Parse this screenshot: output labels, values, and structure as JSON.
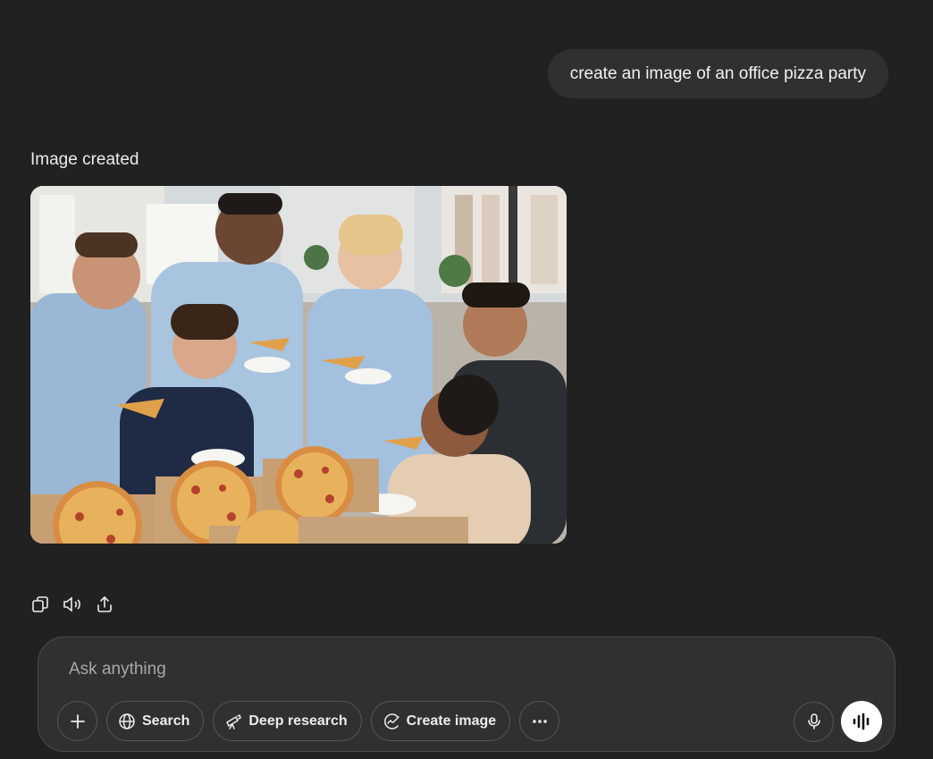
{
  "conversation": {
    "user_message": "create an image of an office pizza party",
    "assistant_label": "Image created"
  },
  "message_actions": [
    {
      "name": "copy-icon"
    },
    {
      "name": "read-aloud-icon"
    },
    {
      "name": "share-icon"
    }
  ],
  "composer": {
    "placeholder": "Ask anything",
    "tools": {
      "add_icon": "plus-icon",
      "search_label": "Search",
      "deep_research_label": "Deep research",
      "create_image_label": "Create image",
      "more_icon": "more-icon"
    },
    "mic_icon": "microphone-icon",
    "voice_icon": "voice-mode-icon"
  },
  "colors": {
    "background": "#212121",
    "bubble": "#303030",
    "composer": "#303030",
    "text": "#ececec"
  }
}
